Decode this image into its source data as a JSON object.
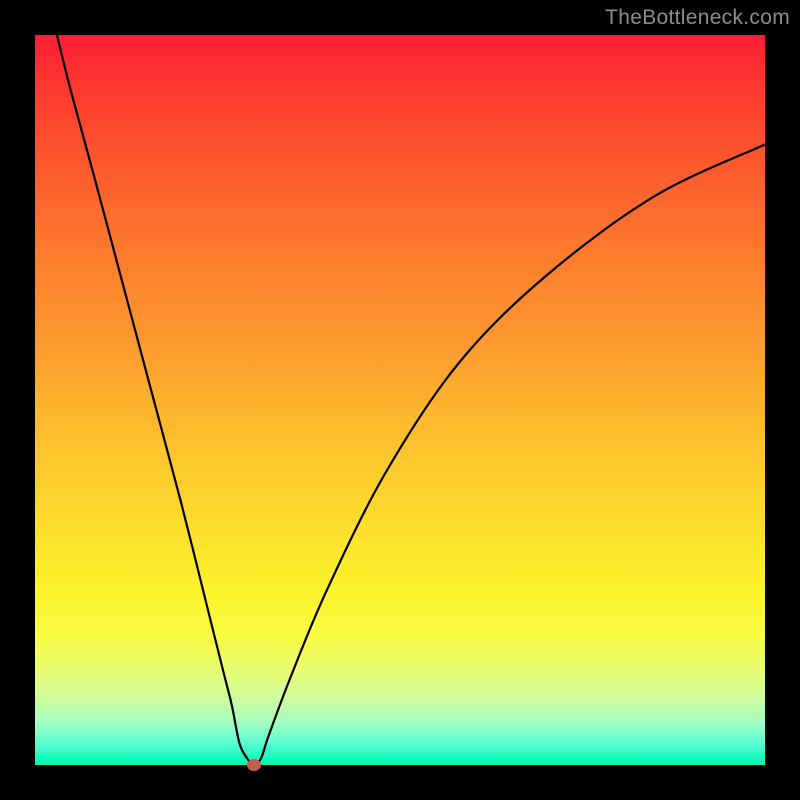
{
  "watermark": "TheBottleneck.com",
  "chart_data": {
    "type": "line",
    "title": "",
    "xlabel": "",
    "ylabel": "",
    "xlim": [
      0,
      100
    ],
    "ylim": [
      0,
      100
    ],
    "grid": false,
    "legend": false,
    "background_gradient": {
      "orientation": "vertical",
      "stops": [
        {
          "pos": 0.0,
          "color": "#fc1e34"
        },
        {
          "pos": 0.3,
          "color": "#fd7b2e"
        },
        {
          "pos": 0.55,
          "color": "#fdbf2d"
        },
        {
          "pos": 0.76,
          "color": "#fcf22c"
        },
        {
          "pos": 0.91,
          "color": "#cdfd9e"
        },
        {
          "pos": 1.0,
          "color": "#05f7a9"
        }
      ],
      "note": "top of plot = high y value (red), bottom = low y value (green)"
    },
    "series": [
      {
        "name": "bottleneck-curve",
        "x": [
          3,
          5,
          8,
          12,
          16,
          20,
          24,
          26,
          27,
          28,
          29,
          30,
          31,
          32,
          35,
          40,
          48,
          58,
          70,
          85,
          100
        ],
        "y": [
          100,
          92,
          81,
          66,
          51,
          36,
          20,
          12,
          8,
          3,
          1,
          0,
          1,
          4,
          12,
          24,
          40,
          55,
          67,
          78,
          85
        ]
      }
    ],
    "marker": {
      "name": "minimum-point",
      "x": 30,
      "y": 0,
      "color": "#c85b4f",
      "shape": "ellipse"
    }
  }
}
